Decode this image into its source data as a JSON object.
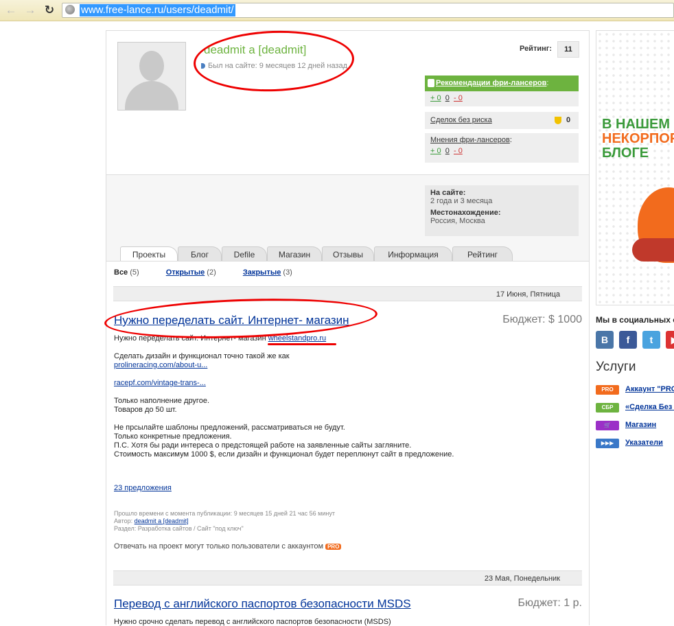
{
  "browser": {
    "url": "www.free-lance.ru/users/deadmit/"
  },
  "profile": {
    "username": "deadmit a [deadmit]",
    "last_seen": "Был на сайте: 9 месяцев 12 дней назад",
    "rating_label": "Рейтинг:",
    "rating_value": "11",
    "recommendations_label": "Рекомендации фри-лансеров",
    "recommendations_colon": ":",
    "rec_scores": {
      "pos": "+ 0",
      "neu": "0",
      "neg": "- 0"
    },
    "deals_label": "Сделок без риска",
    "deals_count": "0",
    "opinions_label": "Мнения фри-лансеров",
    "opinions_colon": ":",
    "op_scores": {
      "pos": "+ 0",
      "neu": "0",
      "neg": "- 0"
    },
    "on_site_label": "На сайте:",
    "on_site_value": "2 года и 3 месяца",
    "location_label": "Местонахождение:",
    "location_value": "Россия, Москва"
  },
  "tabs": [
    "Проекты",
    "Блог",
    "Defile",
    "Магазин",
    "Отзывы",
    "Информация",
    "Рейтинг"
  ],
  "filter": {
    "all_label": "Все",
    "all_count": "(5)",
    "open_label": "Открытые",
    "open_count": "(2)",
    "closed_label": "Закрытые",
    "closed_count": "(3)"
  },
  "project1": {
    "date": "17 Июня, Пятница",
    "title": "Нужно переделать сайт. Интернет- магазин",
    "budget": "Бюджет: $ 1000",
    "line1": "Нужно переделать сайт. Интернет- магазин",
    "link1": "wheelstandpro.ru",
    "line2": "Сделать дизайн и функционал точно такой же как",
    "link2": "prolineracing.com/about-u...",
    "link3": "racepf.com/vintage-trans-...",
    "line3": "Только наполнение другое.",
    "line4": "Товаров до 50 шт.",
    "line5": "Не прсылайте шаблоны предложений, рассматриваться не будут.",
    "line6": "Только конкретные предложения.",
    "line7": "П.С. Хотя бы ради интереса о предстоящей работе на заявленные сайты загляните.",
    "line8": "Стоимость максимум 1000 $, если дизайн и функционал будет переплюнут сайт в предложение.",
    "offers": "23 предложения",
    "elapsed": "Прошло времени с момента публикации: 9 месяцев 15 дней 21 час 56 минут",
    "author_label": "Автор:",
    "author_link": "deadmit a [deadmit]",
    "section": "Раздел: Разработка сайтов / Сайт \"под ключ\"",
    "pro_note": "Отвечать на проект могут только пользователи с аккаунтом",
    "pro_badge": "PRO"
  },
  "project2": {
    "date": "23 Мая, Понедельник",
    "title": "Перевод с английского паспортов безопасности MSDS",
    "budget": "Бюджет: 1 р.",
    "line1": "Нужно срочно сделать перевод с английского паспортов безопасности (MSDS)"
  },
  "sidebar": {
    "banner_line1": "В НАШЕМ",
    "banner_line2": "НЕКОРПОРАТИВНОМ",
    "banner_line3": "БЛОГЕ",
    "social_title": "Мы в социальных сетях",
    "social": [
      {
        "glyph": "В",
        "color": "#4a76a8"
      },
      {
        "glyph": "f",
        "color": "#3b5998"
      },
      {
        "glyph": "t",
        "color": "#4aa3df"
      },
      {
        "glyph": "▶",
        "color": "#d33"
      }
    ],
    "services_title": "Услуги",
    "services": [
      {
        "badge": "PRO",
        "label": "Аккаунт \"PRO\"",
        "color": "#f26b1d"
      },
      {
        "badge": "СБР",
        "label": "«Сделка Без Риска»",
        "color": "#6db33f"
      },
      {
        "badge": "🛒",
        "label": "Магазин",
        "color": "#9b30c7"
      },
      {
        "badge": "▶▶▶",
        "label": "Указатели",
        "color": "#3a78c8"
      }
    ]
  }
}
